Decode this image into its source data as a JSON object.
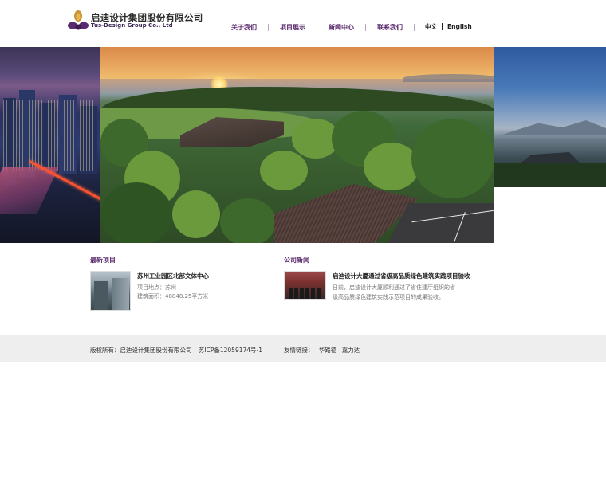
{
  "header": {
    "logo_cn": "启迪设计集团股份有限公司",
    "logo_en": "Tus-Design Group Co., Ltd",
    "nav": [
      {
        "label": "关于我们"
      },
      {
        "label": "项目展示"
      },
      {
        "label": "新闻中心"
      },
      {
        "label": "联系我们"
      }
    ],
    "lang": {
      "zh": "中文",
      "en": "English"
    }
  },
  "projects": {
    "section_title": "最新项目",
    "item": {
      "title": "苏州工业园区北部文体中心",
      "location": "项目地点：苏州",
      "area": "建筑面积：48848.25平方米"
    }
  },
  "news": {
    "section_title": "公司新闻",
    "item": {
      "title": "启迪设计大厦通过省级高品质绿色建筑实践项目验收",
      "desc": "日前，启迪设计大厦顺利通过了省住建厅组织的省级高品质绿色建筑实践示范项目的成果验收。"
    }
  },
  "footer": {
    "copyright": "版权所有：启迪设计集团股份有限公司",
    "icp": "苏ICP备12059174号-1",
    "links_label": "友情链接：",
    "links": [
      "华路德",
      "嘉力达"
    ]
  },
  "colors": {
    "brand_purple": "#5a2a6e",
    "footer_bg": "#eeeeee"
  }
}
